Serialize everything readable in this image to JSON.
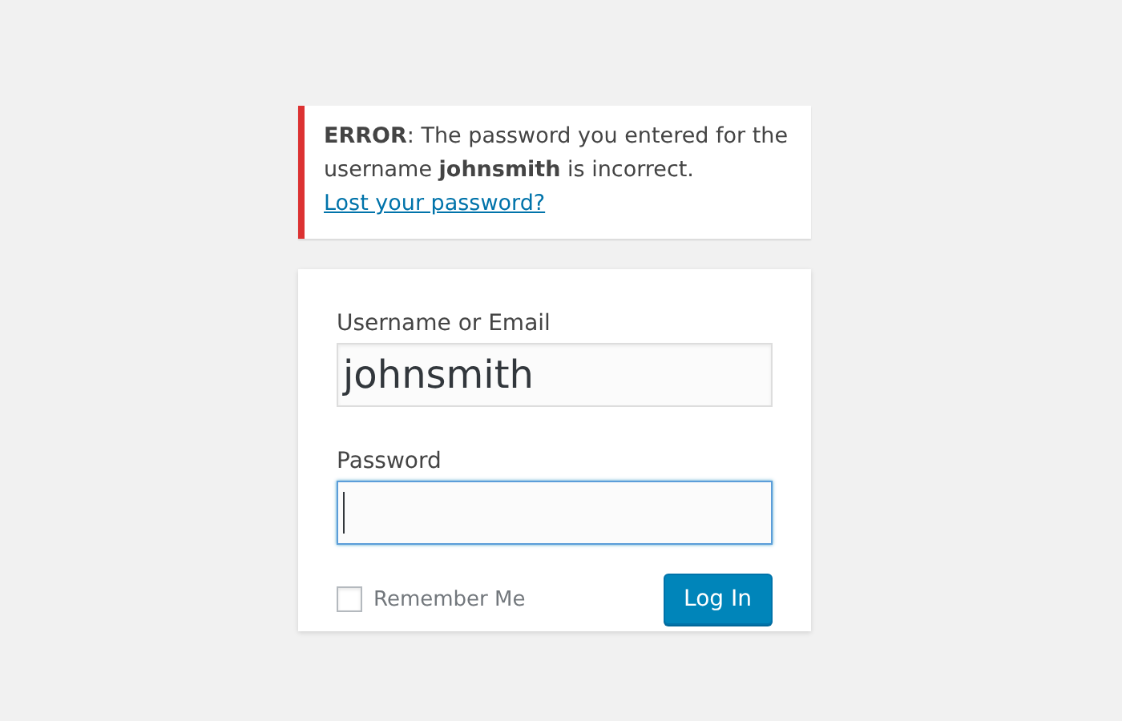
{
  "error": {
    "message": "**ERROR**: The password you entered for the username **johnsmith** is incorrect.",
    "link": "Lost your password?"
  },
  "form": {
    "fields": [
      {
        "label": "Username or Email",
        "value": "johnsmith",
        "focused": false
      },
      {
        "label": "Password",
        "focused": true
      }
    ],
    "remember": {
      "label": "Remember Me",
      "checked": false
    },
    "submit": "Log In"
  }
}
